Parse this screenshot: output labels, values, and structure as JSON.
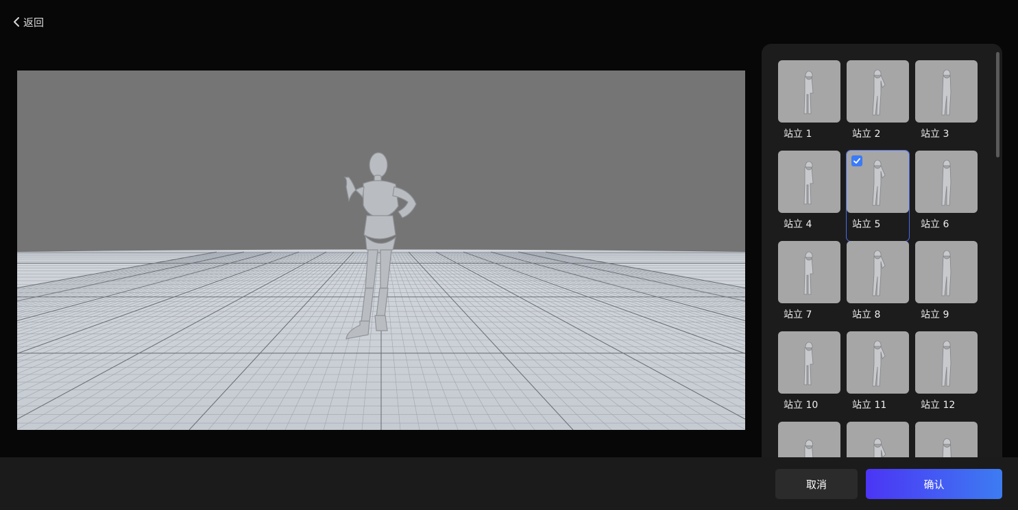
{
  "header": {
    "back_label": "返回"
  },
  "poses": [
    {
      "label": "站立 1",
      "selected": false
    },
    {
      "label": "站立 2",
      "selected": false
    },
    {
      "label": "站立 3",
      "selected": false
    },
    {
      "label": "站立 4",
      "selected": false
    },
    {
      "label": "站立 5",
      "selected": true
    },
    {
      "label": "站立 6",
      "selected": false
    },
    {
      "label": "站立 7",
      "selected": false
    },
    {
      "label": "站立 8",
      "selected": false
    },
    {
      "label": "站立 9",
      "selected": false
    },
    {
      "label": "站立 10",
      "selected": false
    },
    {
      "label": "站立 11",
      "selected": false
    },
    {
      "label": "站立 12",
      "selected": false
    },
    {
      "label": "",
      "selected": false
    },
    {
      "label": "",
      "selected": false
    },
    {
      "label": "",
      "selected": false
    }
  ],
  "footer": {
    "cancel_label": "取消",
    "confirm_label": "确认"
  },
  "colors": {
    "accent_start": "#4b35f5",
    "accent_end": "#3d7cf2",
    "check": "#3b7bf6",
    "panel_bg": "#1c1c1c"
  }
}
